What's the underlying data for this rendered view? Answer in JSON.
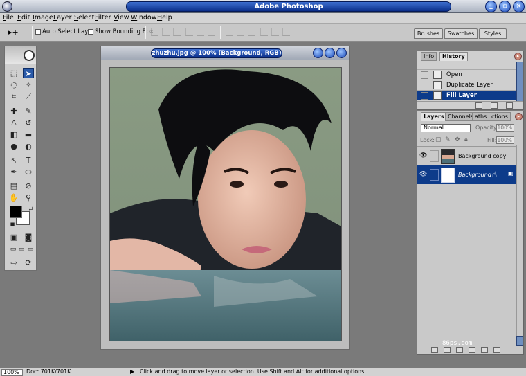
{
  "app": {
    "title": "Adobe Photoshop",
    "window_buttons": [
      "_",
      "▫",
      "×"
    ]
  },
  "menu": [
    "File",
    "Edit",
    "Image",
    "Layer",
    "Select",
    "Filter",
    "View",
    "Window",
    "Help"
  ],
  "options": {
    "tool_preset": "▸+",
    "auto_select_label": "Auto Select Layer",
    "auto_select_checked": false,
    "bounding_box_label": "Show Bounding Box",
    "bounding_box_checked": false
  },
  "palette_well": [
    "Brushes",
    "Swatches",
    "Styles"
  ],
  "toolbox": {
    "tools": [
      "marquee",
      "move",
      "lasso",
      "magic-wand",
      "crop",
      "slice",
      "healing-brush",
      "brush",
      "clone-stamp",
      "history-brush",
      "eraser",
      "gradient",
      "dodge",
      "pen",
      "path-selection",
      "type",
      "pen-tool",
      "shape",
      "notes",
      "eyedropper",
      "hand",
      "zoom"
    ],
    "foreground_color": "#000000",
    "background_color": "#ffffff"
  },
  "document": {
    "title": "zhuzhu.jpg @ 100% (Background, RGB)"
  },
  "history": {
    "tabs": [
      "Info",
      "History"
    ],
    "active_tab": "History",
    "items": [
      {
        "label": "Open",
        "selected": false
      },
      {
        "label": "Duplicate Layer",
        "selected": false
      },
      {
        "label": "Fill Layer",
        "selected": true
      }
    ]
  },
  "layers": {
    "tabs": [
      "Layers",
      "Channels",
      "Paths",
      "Actions"
    ],
    "tab_labels_shown": [
      "Layers",
      "Channels",
      "aths",
      "ctions"
    ],
    "active_tab": "Layers",
    "blend_mode": "Normal",
    "opacity_label": "Opacity:",
    "opacity": "100%",
    "lock_label": "Lock:",
    "fill_label": "Fill:",
    "fill": "100%",
    "items": [
      {
        "name": "Background copy",
        "selected": false,
        "locked": false
      },
      {
        "name": "Background",
        "selected": true,
        "locked": true
      }
    ],
    "watermark": "86ps.com"
  },
  "status": {
    "zoom": "100%",
    "doc_size": "Doc: 701K/701K",
    "hint": "Click and drag to move layer or selection.  Use Shift and Alt for additional options."
  },
  "colors": {
    "accent": "#0d3b8a",
    "title_bar": "#0b2f8a",
    "workspace": "#7a7a7a"
  }
}
